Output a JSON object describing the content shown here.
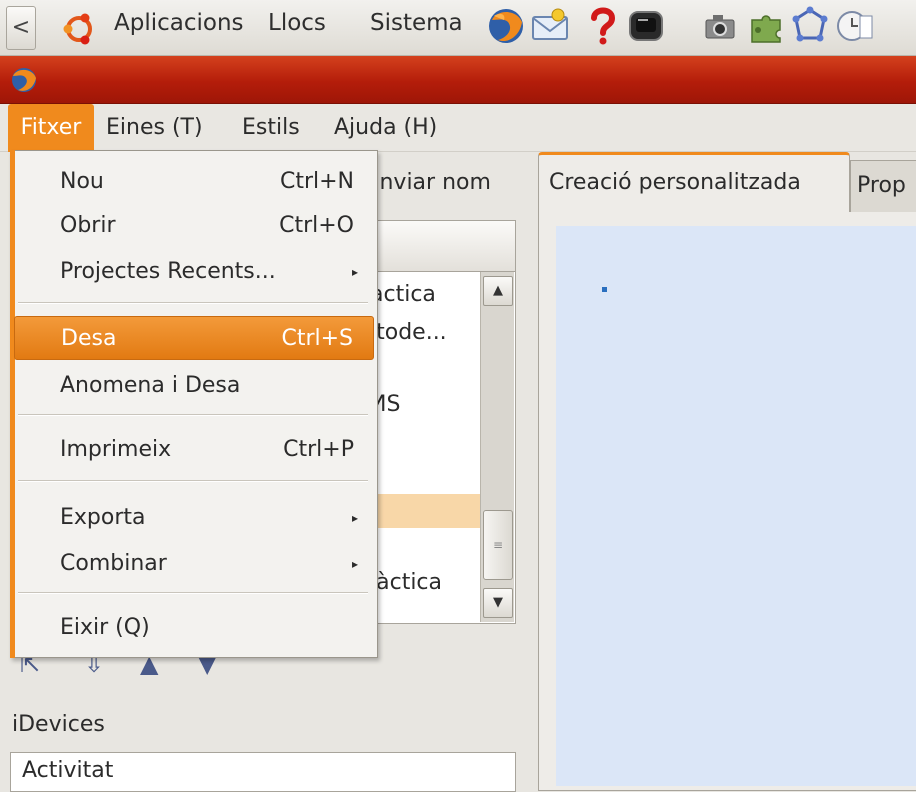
{
  "panel": {
    "back_arrow": "<",
    "menus": [
      "Aplicacions",
      "Llocs",
      "Sistema"
    ],
    "launchers": [
      "firefox-icon",
      "mail-icon",
      "help-icon",
      "screen-icon",
      "camera-icon",
      "puzzle-icon",
      "network-icon",
      "clock-notes-icon"
    ]
  },
  "window": {
    "title_icon": "firefox-icon"
  },
  "menubar": {
    "items": [
      "Fitxer",
      "Eines (T)",
      "Estils",
      "Ajuda (H)"
    ]
  },
  "file_menu": {
    "items": [
      {
        "label": "Nou",
        "accel": "Ctrl+N"
      },
      {
        "label": "Obrir",
        "accel": "Ctrl+O"
      },
      {
        "label": "Projectes Recents...",
        "submenu": "▸"
      },
      {
        "label": "Desa",
        "accel": "Ctrl+S",
        "selected": true
      },
      {
        "label": "Anomena i Desa",
        "accel": ""
      },
      {
        "label": "Imprimeix",
        "accel": "Ctrl+P"
      },
      {
        "label": "Exporta",
        "submenu": "▸"
      },
      {
        "label": "Combinar",
        "submenu": "▸"
      },
      {
        "label": "Eixir (Q)",
        "accel": ""
      }
    ]
  },
  "left_pane": {
    "rename_button_fragment": "anviar nom",
    "outline_fragments": [
      "àctica",
      "ıtode...",
      "ИS",
      "làctica"
    ],
    "scroll_up": "▲",
    "scroll_down": "▼",
    "scroll_grip": "≡",
    "nav_arrows": [
      "⇱",
      "⇩",
      "▲",
      "▼"
    ],
    "idevices_label": "iDevices",
    "idevices_first": "Activitat"
  },
  "right_pane": {
    "tabs": [
      "Creació personalitzada",
      "Prop"
    ]
  },
  "colors": {
    "accent": "#f08a1d",
    "titlebar": "#b41d0a",
    "canvas": "#dbe6f7"
  }
}
